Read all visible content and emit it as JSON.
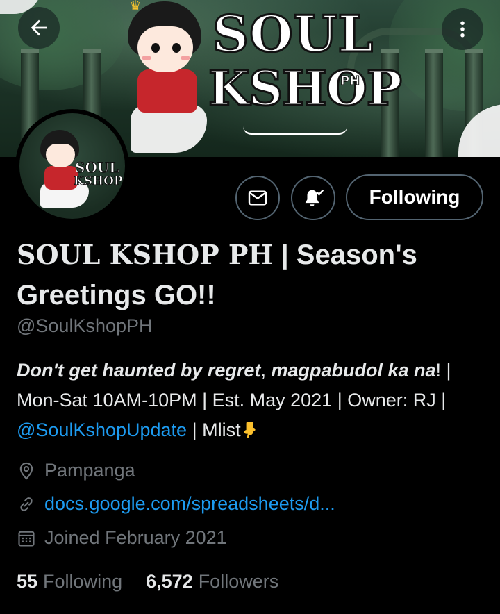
{
  "banner": {
    "logo_line1": "SOUL",
    "logo_line2": "KSHOP",
    "logo_suffix": "PH"
  },
  "avatar": {
    "logo_line1": "SOUL",
    "logo_line2": "KSHOP"
  },
  "icons": {
    "back": "arrow-left-icon",
    "more": "more-vertical-icon",
    "mail": "mail-icon",
    "bell": "notification-bell-check-icon",
    "location": "location-pin-icon",
    "link": "link-icon",
    "calendar": "calendar-icon",
    "emoji": "backhand-index-pointing-down-emoji"
  },
  "actions": {
    "following_label": "Following"
  },
  "profile": {
    "name_part1": "SOUL KSHOP PH",
    "name_part2": " | Season's Greetings GO!!",
    "handle": "@SoulKshopPH",
    "bio": {
      "part1_bold_italic": "Don't get haunted by regret",
      "part2": ", ",
      "part3_bold_italic": "magpabudol ka na",
      "part4": "! | Mon-Sat 10AM-10PM | Est. May 2021 | Owner: RJ | ",
      "mention": "@SoulKshopUpdate",
      "part5": " | Mlist"
    },
    "location": "Pampanga",
    "website": "docs.google.com/spreadsheets/d...",
    "joined": "Joined February 2021"
  },
  "stats": {
    "following_count": "55",
    "following_label": "Following",
    "followers_count": "6,572",
    "followers_label": "Followers"
  },
  "colors": {
    "background": "#000000",
    "text_primary": "#e7e9ea",
    "text_secondary": "#71767b",
    "link": "#1d9bf0",
    "button_border": "#536471"
  }
}
